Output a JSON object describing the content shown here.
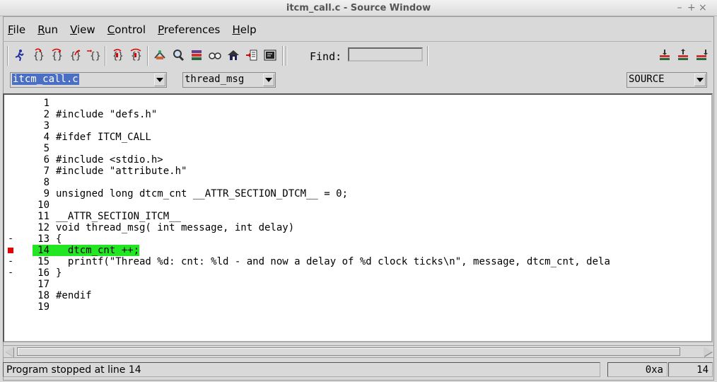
{
  "window": {
    "title": "itcm_call.c - Source Window",
    "controls": [
      "–",
      "+",
      "×"
    ]
  },
  "menu": [
    "File",
    "Run",
    "View",
    "Control",
    "Preferences",
    "Help"
  ],
  "toolbar": {
    "left_icons": [
      "run-icon",
      "step-icon",
      "next-icon",
      "finish-icon",
      "continue-icon",
      "stepi-icon",
      "nexti-icon",
      "watch-icon",
      "local-vars-icon",
      "registers-icon",
      "memory-icon",
      "stack-icon",
      "console-icon",
      "source-icon"
    ],
    "find_label": "Find:",
    "find_value": "",
    "right_icons": [
      "down-frame-icon",
      "up-frame-icon",
      "bottom-frame-icon"
    ]
  },
  "selectors": {
    "file": "itcm_call.c",
    "function": "thread_msg",
    "mode": "SOURCE"
  },
  "source": [
    {
      "num": "1",
      "text": "",
      "marker": ""
    },
    {
      "num": "2",
      "text": "#include \"defs.h\"",
      "marker": ""
    },
    {
      "num": "3",
      "text": "",
      "marker": ""
    },
    {
      "num": "4",
      "text": "#ifdef ITCM_CALL",
      "marker": ""
    },
    {
      "num": "5",
      "text": "",
      "marker": ""
    },
    {
      "num": "6",
      "text": "#include <stdio.h>",
      "marker": ""
    },
    {
      "num": "7",
      "text": "#include \"attribute.h\"",
      "marker": ""
    },
    {
      "num": "8",
      "text": "",
      "marker": ""
    },
    {
      "num": "9",
      "text": "unsigned long dtcm_cnt __ATTR_SECTION_DTCM__ = 0;",
      "marker": ""
    },
    {
      "num": "10",
      "text": "",
      "marker": ""
    },
    {
      "num": "11",
      "text": "__ATTR_SECTION_ITCM__",
      "marker": ""
    },
    {
      "num": "12",
      "text": "void thread_msg( int message, int delay)",
      "marker": ""
    },
    {
      "num": "13",
      "text": "{",
      "marker": "-"
    },
    {
      "num": "14",
      "text": "  dtcm_cnt ++;",
      "marker": "bp",
      "current": true
    },
    {
      "num": "15",
      "text": "  printf(\"Thread %d: cnt: %ld - and now a delay of %d clock ticks\\n\", message, dtcm_cnt, dela",
      "marker": "-"
    },
    {
      "num": "16",
      "text": "}",
      "marker": "-"
    },
    {
      "num": "17",
      "text": "",
      "marker": ""
    },
    {
      "num": "18",
      "text": "#endif",
      "marker": ""
    },
    {
      "num": "19",
      "text": "",
      "marker": ""
    }
  ],
  "status": {
    "message": "Program stopped at line 14",
    "address": "0xa",
    "line": "14"
  },
  "colors": {
    "current_line": "#22e622",
    "breakpoint": "#e60000",
    "selection": "#4a6fc4"
  }
}
